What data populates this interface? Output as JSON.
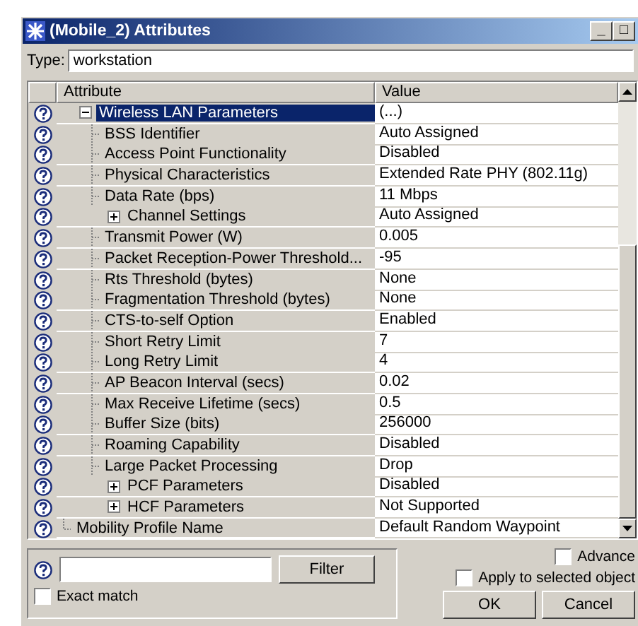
{
  "window": {
    "title": "(Mobile_2) Attributes",
    "controls": [
      "_",
      "□"
    ]
  },
  "type_field": {
    "label": "Type:",
    "value": "workstation"
  },
  "table": {
    "columns": [
      "Attribute",
      "Value"
    ],
    "rows": [
      {
        "attribute": "Wireless LAN Parameters",
        "value": "(...)",
        "expanded": true,
        "selected": true,
        "children": [
          {
            "attribute": "BSS Identifier",
            "value": "Auto Assigned",
            "selected": false
          },
          {
            "attribute": "Access Point Functionality",
            "value": "Disabled",
            "selected": false
          },
          {
            "attribute": "Physical Characteristics",
            "value": "Extended Rate PHY (802.11g)",
            "selected": false
          },
          {
            "attribute": "Data Rate (bps)",
            "value": "11 Mbps",
            "selected": false
          },
          {
            "attribute": "Channel Settings",
            "value": "Auto Assigned",
            "expanded": false,
            "selected": false
          },
          {
            "attribute": "Transmit Power (W)",
            "value": "0.005",
            "selected": false
          },
          {
            "attribute": "Packet Reception-Power Threshold...",
            "value": "-95",
            "selected": false
          },
          {
            "attribute": "Rts Threshold (bytes)",
            "value": "None",
            "selected": false
          },
          {
            "attribute": "Fragmentation Threshold (bytes)",
            "value": "None",
            "selected": false
          },
          {
            "attribute": "CTS-to-self Option",
            "value": "Enabled",
            "selected": false
          },
          {
            "attribute": "Short Retry Limit",
            "value": "7",
            "selected": false
          },
          {
            "attribute": "Long Retry Limit",
            "value": "4",
            "selected": false
          },
          {
            "attribute": "AP Beacon Interval (secs)",
            "value": "0.02",
            "selected": false
          },
          {
            "attribute": "Max Receive Lifetime (secs)",
            "value": "0.5",
            "selected": false
          },
          {
            "attribute": "Buffer Size (bits)",
            "value": "256000",
            "selected": false
          },
          {
            "attribute": "Roaming Capability",
            "value": "Disabled",
            "selected": false
          },
          {
            "attribute": "Large Packet Processing",
            "value": "Drop",
            "selected": false
          },
          {
            "attribute": "PCF Parameters",
            "value": "Disabled",
            "expanded": false,
            "selected": false
          },
          {
            "attribute": "HCF Parameters",
            "value": "Not Supported",
            "expanded": false,
            "selected": false
          }
        ]
      },
      {
        "attribute": "Mobility Profile Name",
        "value": "Default Random Waypoint",
        "selected": false
      }
    ]
  },
  "filter": {
    "button": "Filter",
    "exact_match": {
      "label": "Exact match",
      "checked": false
    }
  },
  "advanced": {
    "label": "Advance",
    "checked": false
  },
  "apply_selected": {
    "label": "Apply to selected object",
    "checked": false
  },
  "buttons": [
    "OK",
    "Cancel"
  ]
}
